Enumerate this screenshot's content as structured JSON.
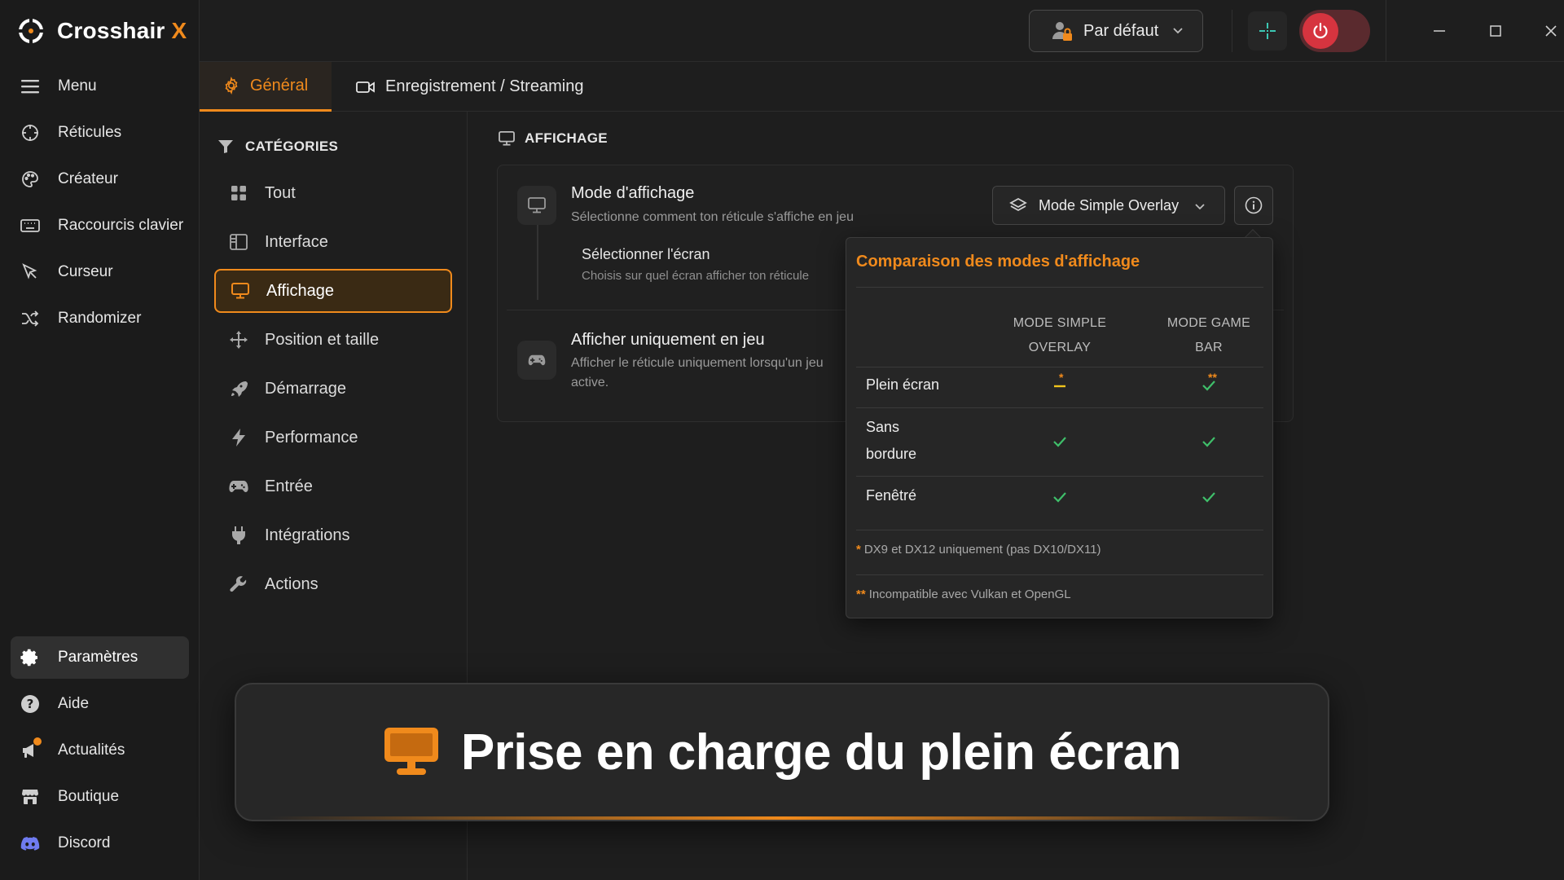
{
  "app": {
    "name": "Crosshair",
    "name_accent": "X"
  },
  "sidebar": {
    "items": [
      {
        "label": "Menu",
        "icon": "hamburger-icon"
      },
      {
        "label": "Réticules",
        "icon": "crosshair-icon"
      },
      {
        "label": "Créateur",
        "icon": "palette-icon"
      },
      {
        "label": "Raccourcis clavier",
        "icon": "keyboard-icon"
      },
      {
        "label": "Curseur",
        "icon": "cursor-icon"
      },
      {
        "label": "Randomizer",
        "icon": "shuffle-icon"
      }
    ],
    "bottom_items": [
      {
        "label": "Paramètres",
        "icon": "gear-icon",
        "active": true
      },
      {
        "label": "Aide",
        "icon": "help-icon"
      },
      {
        "label": "Actualités",
        "icon": "megaphone-icon"
      },
      {
        "label": "Boutique",
        "icon": "store-icon"
      },
      {
        "label": "Discord",
        "icon": "discord-icon"
      }
    ]
  },
  "topbar": {
    "profile": "Par défaut",
    "window_controls": [
      "minimize-icon",
      "maximize-icon",
      "close-icon"
    ]
  },
  "tabs": [
    {
      "label": "Général",
      "icon": "gear-icon",
      "active": true
    },
    {
      "label": "Enregistrement / Streaming",
      "icon": "camera-icon"
    }
  ],
  "categories": {
    "title": "CATÉGORIES",
    "items": [
      {
        "label": "Tout",
        "icon": "grid-icon"
      },
      {
        "label": "Interface",
        "icon": "layout-icon"
      },
      {
        "label": "Affichage",
        "icon": "monitor-icon",
        "active": true
      },
      {
        "label": "Position et taille",
        "icon": "move-icon"
      },
      {
        "label": "Démarrage",
        "icon": "rocket-icon"
      },
      {
        "label": "Performance",
        "icon": "bolt-icon"
      },
      {
        "label": "Entrée",
        "icon": "gamepad-icon"
      },
      {
        "label": "Intégrations",
        "icon": "plug-icon"
      },
      {
        "label": "Actions",
        "icon": "wrench-icon"
      }
    ]
  },
  "section": {
    "title": "AFFICHAGE",
    "display_mode": {
      "title": "Mode d'affichage",
      "desc": "Sélectionne comment ton réticule s'affiche en jeu",
      "value": "Mode Simple Overlay"
    },
    "select_screen": {
      "title": "Sélectionner l'écran",
      "desc": "Choisis sur quel écran afficher ton réticule"
    },
    "ingame_only": {
      "title": "Afficher uniquement en jeu",
      "desc_line1": "Afficher le réticule uniquement lorsqu'un jeu",
      "desc_line2": "active."
    }
  },
  "popover": {
    "title": "Comparaison des modes d'affichage",
    "col1_line1": "MODE SIMPLE",
    "col1_line2": "OVERLAY",
    "col2_line1": "MODE GAME",
    "col2_line2": "BAR",
    "rows": [
      {
        "label": "Plein écran",
        "simple": "partial",
        "simple_note": "*",
        "gamebar": "yes",
        "gamebar_note": "**"
      },
      {
        "label_line1": "Sans",
        "label_line2": "bordure",
        "simple": "yes",
        "gamebar": "yes"
      },
      {
        "label": "Fenêtré",
        "simple": "yes",
        "gamebar": "yes"
      }
    ],
    "footnote1_mark": "*",
    "footnote1": "DX9 et DX12 uniquement (pas DX10/DX11)",
    "footnote2_mark": "**",
    "footnote2": "Incompatible avec Vulkan et OpenGL"
  },
  "banner": {
    "text": "Prise en charge du plein écran",
    "icon": "monitor-icon"
  },
  "colors": {
    "accent": "#f08a1c",
    "check": "#3fbf6a",
    "power": "#d6343f",
    "background": "#1e1e1e"
  }
}
